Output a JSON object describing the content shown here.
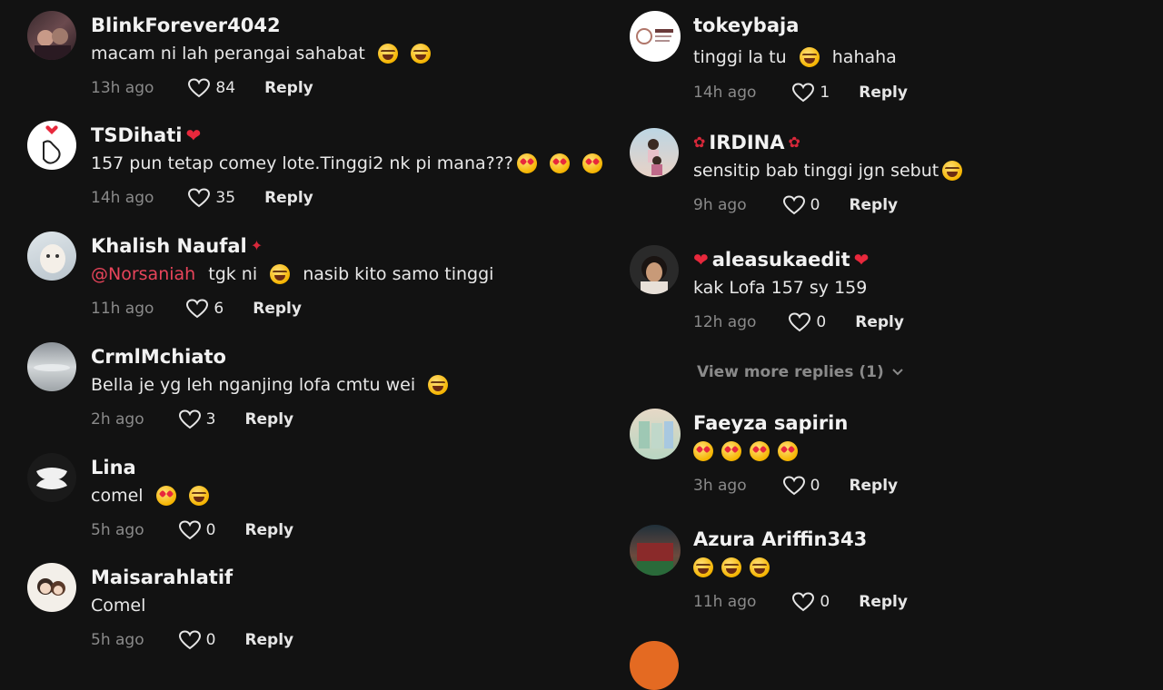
{
  "left_comments": [
    {
      "username": "BlinkForever4042",
      "text": "macam ni lah perangai sahabat",
      "time": "13h ago",
      "likes": "84",
      "reply": "Reply"
    },
    {
      "username": "TSDihati",
      "text": "157 pun tetap comey lote.Tinggi2 nk pi mana???",
      "time": "14h ago",
      "likes": "35",
      "reply": "Reply"
    },
    {
      "username": "Khalish Naufal",
      "mention": "@Norsaniah",
      "text": "tgk ni",
      "text2": "nasib kito samo tinggi",
      "time": "11h ago",
      "likes": "6",
      "reply": "Reply"
    },
    {
      "username": "CrmlMchiato",
      "text": "Bella je yg leh nganjing lofa cmtu wei",
      "time": "2h ago",
      "likes": "3",
      "reply": "Reply"
    },
    {
      "username": "Lina",
      "text": "comel",
      "time": "5h ago",
      "likes": "0",
      "reply": "Reply"
    },
    {
      "username": "Maisarahlatif",
      "text": "Comel",
      "time": "5h ago",
      "likes": "0",
      "reply": "Reply"
    }
  ],
  "right_comments": [
    {
      "username": "tokeybaja",
      "text": "tinggi la tu",
      "text2": "hahaha",
      "time": "14h ago",
      "likes": "1",
      "reply": "Reply"
    },
    {
      "username": "IRDINA",
      "text": "sensitip bab tinggi jgn sebut",
      "time": "9h ago",
      "likes": "0",
      "reply": "Reply"
    },
    {
      "username": "aleasukaedit",
      "text": "kak Lofa 157 sy 159",
      "time": "12h ago",
      "likes": "0",
      "reply": "Reply"
    },
    {
      "username": "Faeyza sapirin",
      "text": "",
      "time": "3h ago",
      "likes": "0",
      "reply": "Reply"
    },
    {
      "username": "Azura Ariffin343",
      "text": "",
      "time": "11h ago",
      "likes": "0",
      "reply": "Reply"
    }
  ],
  "view_more": "View more replies (1)",
  "icons": {
    "like": "heart-outline-icon",
    "expand": "chevron-down-icon"
  },
  "colors": {
    "background": "#121212",
    "mention": "#e8445a",
    "muted": "#8a8a8a",
    "heart_emoji": "#e8283c"
  }
}
